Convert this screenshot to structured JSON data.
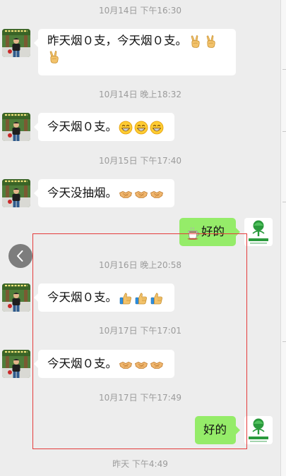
{
  "messages": {
    "ts1": "10月14日 下午16:30",
    "m1_line1": "昨天烟０支，今天烟０支。",
    "ts2": "10月14日 晚上18:32",
    "m2": "今天烟０支。",
    "ts3": "10月15日 下午17:40",
    "m3": "今天没抽烟。",
    "m4_reply": "好的",
    "ts4": "10月16日 晚上20:58",
    "m5": "今天烟０支。",
    "ts5": "10月17日 下午17:01",
    "m6": "今天烟０支。",
    "ts6": "10月17日 下午17:49",
    "m7_reply": "好的",
    "ts7": "昨天 下午4:49"
  },
  "icons": {
    "victory": "victory-hand-emoji",
    "grin": "grinning-face-emoji",
    "handshake": "handshake-emoji",
    "thumbs_up": "thumbs-up-emoji",
    "coffee": "hot-beverage-emoji",
    "back": "chevron-left-icon"
  },
  "colors": {
    "background": "#ededed",
    "bubble_left": "#ffffff",
    "bubble_right": "#95ec69",
    "timestamp": "#9b9b9b",
    "highlight_box": "#e43b3b"
  }
}
